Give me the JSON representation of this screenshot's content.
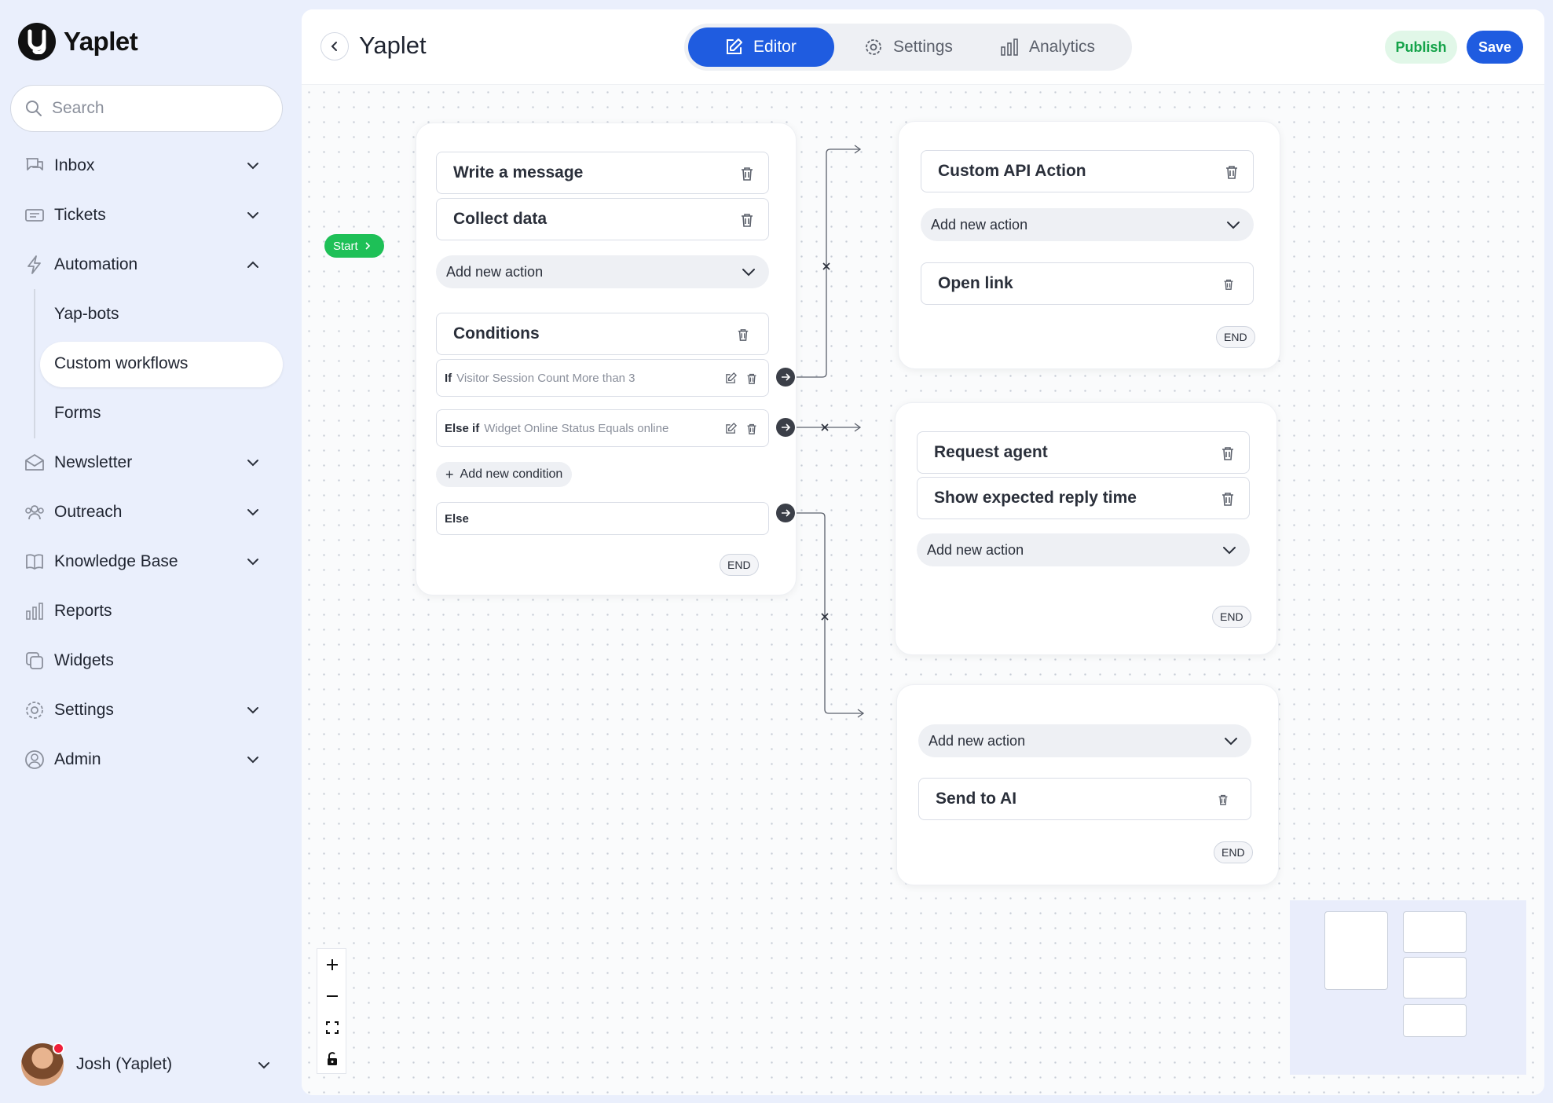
{
  "app": {
    "name": "Yaplet"
  },
  "search": {
    "placeholder": "Search"
  },
  "nav": {
    "inbox": "Inbox",
    "tickets": "Tickets",
    "automation": "Automation",
    "yapbots": "Yap-bots",
    "custom_workflows": "Custom workflows",
    "forms": "Forms",
    "newsletter": "Newsletter",
    "outreach": "Outreach",
    "knowledge_base": "Knowledge Base",
    "reports": "Reports",
    "widgets": "Widgets",
    "settings": "Settings",
    "admin": "Admin"
  },
  "user": {
    "name": "Josh (Yaplet)"
  },
  "header": {
    "title": "Yaplet",
    "tabs": {
      "editor": "Editor",
      "settings": "Settings",
      "analytics": "Analytics"
    },
    "publish": "Publish",
    "save": "Save"
  },
  "flow": {
    "start": "Start",
    "main": {
      "write_message": "Write a message",
      "collect_data": "Collect data",
      "add_action": "Add new action",
      "conditions": "Conditions",
      "if_kw": "If",
      "if_text": "Visitor Session Count More than 3",
      "elseif_kw": "Else if",
      "elseif_text": "Widget Online Status Equals online",
      "add_condition": "Add new condition",
      "else": "Else",
      "end": "END"
    },
    "branch1": {
      "custom_api": "Custom API Action",
      "add_action": "Add new action",
      "open_link": "Open link",
      "end": "END"
    },
    "branch2": {
      "request_agent": "Request agent",
      "show_reply_time": "Show expected reply time",
      "add_action": "Add new action",
      "end": "END"
    },
    "branch3": {
      "add_action": "Add new action",
      "send_ai": "Send to AI",
      "end": "END"
    }
  },
  "colors": {
    "primary": "#1f5ce0",
    "start_green": "#1ec057",
    "publish_green": "#15a34a",
    "sidebar_bg": "#eaeffc"
  }
}
